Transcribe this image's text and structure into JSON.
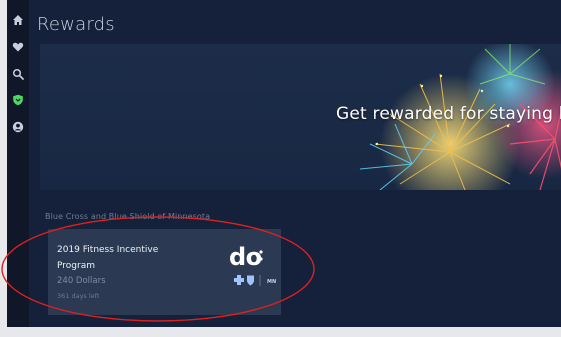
{
  "sidebar": {
    "items": [
      {
        "icon": "home-icon"
      },
      {
        "icon": "heart-icon"
      },
      {
        "icon": "search-icon"
      },
      {
        "icon": "shield-icon",
        "active": true
      },
      {
        "icon": "user-icon"
      }
    ],
    "active_color": "#4cd964"
  },
  "page": {
    "title": "Rewards"
  },
  "hero": {
    "text": "Get rewarded for staying h"
  },
  "section": {
    "org_name": "Blue Cross and Blue Shield of Minnesota"
  },
  "reward_card": {
    "title": "2019 Fitness Incentive Program",
    "amount": "240 Dollars",
    "days_left": "361 days left",
    "logo_text": "do",
    "logo_state": "MN"
  },
  "colors": {
    "background": "#15213a",
    "card": "#2b3a52",
    "annotation": "#e02020"
  }
}
